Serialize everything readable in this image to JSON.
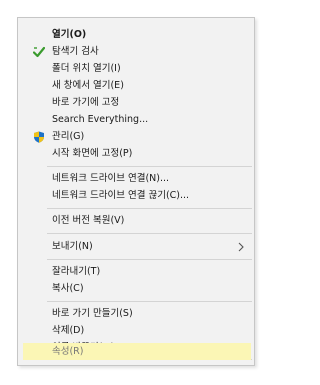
{
  "context_menu": {
    "items": [
      {
        "label": "열기(O)",
        "bold": true
      },
      {
        "label": "탐색기 검사",
        "icon": "defender-checkmark-icon"
      },
      {
        "label": "폴더 위치 열기(I)"
      },
      {
        "label": "새 창에서 열기(E)"
      },
      {
        "label": "바로 가기에 고정"
      },
      {
        "label": "Search Everything..."
      },
      {
        "label": "관리(G)",
        "icon": "uac-shield-icon"
      },
      {
        "label": "시작 화면에 고정(P)"
      },
      {
        "label": "네트워크 드라이브 연결(N)..."
      },
      {
        "label": "네트워크 드라이브 연결 끊기(C)..."
      },
      {
        "label": "이전 버전 복원(V)"
      },
      {
        "label": "보내기(N)",
        "submenu_icon": "chevron-right-icon"
      },
      {
        "label": "잘라내기(T)"
      },
      {
        "label": "복사(C)"
      },
      {
        "label": "바로 가기 만들기(S)"
      },
      {
        "label": "삭제(D)"
      },
      {
        "label": "이름 바꾸기(M)"
      },
      {
        "label": "속성(R)",
        "highlighted": true
      }
    ]
  },
  "colors": {
    "menu_background": "#f2f2f2",
    "highlight": "#fbf6b5",
    "separator": "#d4d4d4",
    "shield_blue": "#1e73c8",
    "shield_yellow": "#f2c318",
    "check_green": "#3a9b2e"
  }
}
